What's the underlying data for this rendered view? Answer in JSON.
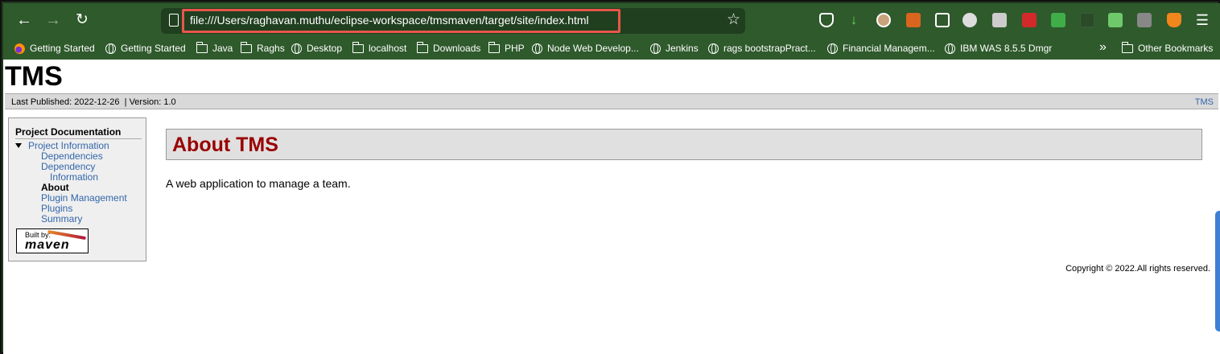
{
  "browser": {
    "url": "file:///Users/raghavan.muthu/eclipse-workspace/tmsmaven/target/site/index.html",
    "colors": {
      "toolbar": "#2f5a2c",
      "url_highlight": "#e8574a"
    },
    "extensions": [
      {
        "name": "pocket-icon",
        "color": "#ffffff"
      },
      {
        "name": "download-icon",
        "color": "#5bd35b"
      },
      {
        "name": "profile-icon",
        "color": "#c8a27a"
      },
      {
        "name": "ext-orange-icon",
        "color": "#d9651e"
      },
      {
        "name": "clipboard-icon",
        "color": "#ffffff"
      },
      {
        "name": "ext-dots-icon",
        "color": "#dddddd"
      },
      {
        "name": "reader-icon",
        "color": "#cccccc"
      },
      {
        "name": "ext-red-icon",
        "color": "#d22a2a"
      },
      {
        "name": "ext-green-icon",
        "color": "#3fae49"
      },
      {
        "name": "ext-dark-icon",
        "color": "#444444"
      },
      {
        "name": "ext-clip-icon",
        "color": "#6fc96a"
      },
      {
        "name": "ext-tool-icon",
        "color": "#888888"
      },
      {
        "name": "metamask-icon",
        "color": "#f0861c"
      },
      {
        "name": "menu-icon",
        "color": "#ffffff"
      }
    ]
  },
  "bookmarks": {
    "items": [
      {
        "label": "Getting Started",
        "icon": "firefox-icon"
      },
      {
        "label": "Getting Started",
        "icon": "globe-icon"
      },
      {
        "label": "Java",
        "icon": "folder-icon"
      },
      {
        "label": "Raghs",
        "icon": "folder-icon"
      },
      {
        "label": "Desktop",
        "icon": "globe-icon"
      },
      {
        "label": "localhost",
        "icon": "folder-icon"
      },
      {
        "label": "Downloads",
        "icon": "folder-icon"
      },
      {
        "label": "PHP",
        "icon": "folder-icon"
      },
      {
        "label": "Node Web Develop...",
        "icon": "globe-icon"
      },
      {
        "label": "Jenkins",
        "icon": "globe-icon"
      },
      {
        "label": "rags bootstrapPract...",
        "icon": "globe-icon"
      },
      {
        "label": "Financial Managem...",
        "icon": "globe-icon"
      },
      {
        "label": "IBM WAS 8.5.5 Dmgr",
        "icon": "globe-icon"
      }
    ],
    "overflow": "»",
    "other": "Other Bookmarks"
  },
  "site": {
    "title": "TMS",
    "published": "Last Published: 2022-12-26  | Version: 1.0",
    "top_right_link": "TMS",
    "colors": {
      "heading": "#990000",
      "link": "#3366aa",
      "banner": "#d9d9d9"
    }
  },
  "sidebar": {
    "title": "Project Documentation",
    "section": "Project Information",
    "items": [
      "Dependencies",
      "Dependency",
      "Information",
      "About",
      "Plugin Management",
      "Plugins",
      "Summary"
    ],
    "logo_built_by": "Built by:",
    "logo_word": "maven"
  },
  "content": {
    "heading": "About TMS",
    "text": "A web application to manage a team."
  },
  "footer": {
    "copyright": "Copyright © 2022.All rights reserved."
  }
}
